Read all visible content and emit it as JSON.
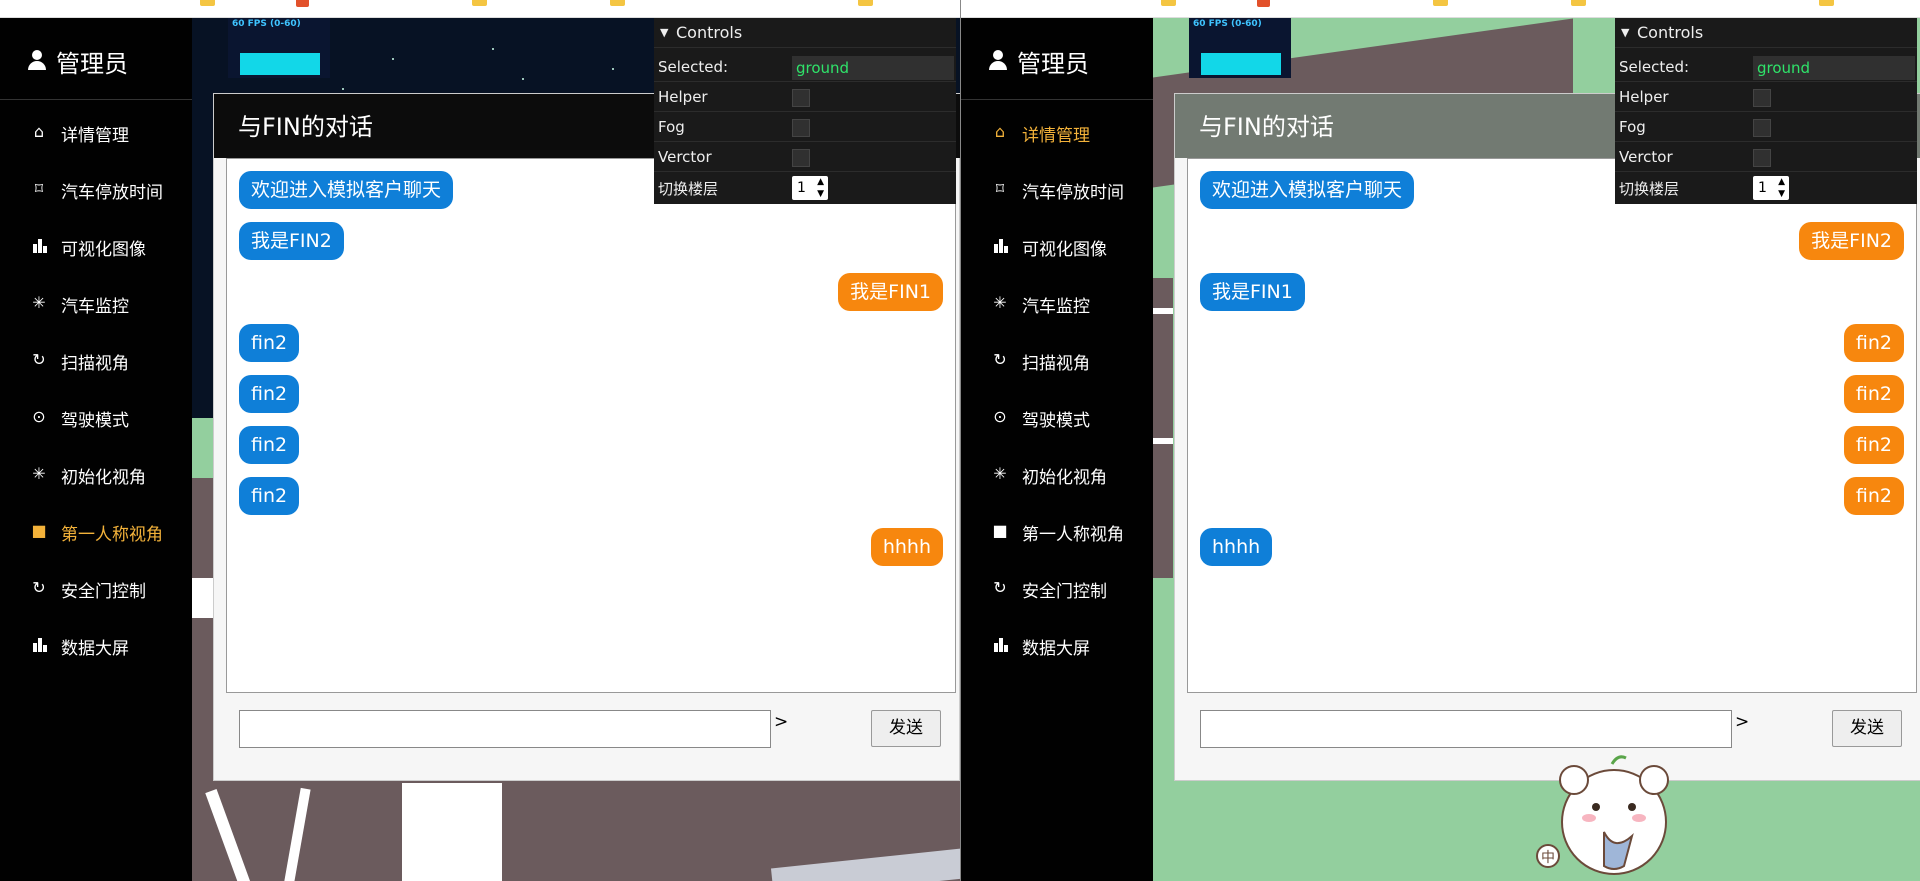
{
  "colors": {
    "sidebar_bg": "#010101",
    "active_nav": "#f3b23a",
    "bubble_blue": "#0f7fd8",
    "bubble_orange": "#f7870e",
    "gui_value_green": "#2fe36a"
  },
  "panels": [
    {
      "sidebar": {
        "admin_name": "管理员",
        "items": [
          {
            "label": "详情管理",
            "icon": "home-icon"
          },
          {
            "label": "汽车停放时间",
            "icon": "bookmark-icon"
          },
          {
            "label": "可视化图像",
            "icon": "bar-chart-icon"
          },
          {
            "label": "汽车监控",
            "icon": "spinner-icon"
          },
          {
            "label": "扫描视角",
            "icon": "scan-icon"
          },
          {
            "label": "驾驶模式",
            "icon": "location-icon"
          },
          {
            "label": "初始化视角",
            "icon": "spinner-icon"
          },
          {
            "label": "第一人称视角",
            "icon": "camera-icon"
          },
          {
            "label": "安全门控制",
            "icon": "scan-icon"
          },
          {
            "label": "数据大屏",
            "icon": "bar-chart-icon"
          }
        ],
        "active_index": 7
      },
      "fps": "60 FPS (0-60)",
      "controls": {
        "title": "Controls",
        "selected_label": "Selected:",
        "selected_value": "ground",
        "helper_label": "Helper",
        "fog_label": "Fog",
        "vector_label": "Verctor",
        "floor_label": "切换楼层",
        "floor_value": "1"
      },
      "chat": {
        "title": "与FIN的对话",
        "messages": [
          {
            "text": "欢迎进入模拟客户聊天",
            "side": "left"
          },
          {
            "text": "我是FIN2",
            "side": "left"
          },
          {
            "text": "我是FIN1",
            "side": "right"
          },
          {
            "text": "fin2",
            "side": "left"
          },
          {
            "text": "fin2",
            "side": "left"
          },
          {
            "text": "fin2",
            "side": "left"
          },
          {
            "text": "fin2",
            "side": "left"
          },
          {
            "text": "hhhh",
            "side": "right"
          }
        ],
        "input_value": "",
        "prompt_symbol": ">",
        "send_label": "发送"
      }
    },
    {
      "sidebar": {
        "admin_name": "管理员",
        "items": [
          {
            "label": "详情管理",
            "icon": "home-icon"
          },
          {
            "label": "汽车停放时间",
            "icon": "bookmark-icon"
          },
          {
            "label": "可视化图像",
            "icon": "bar-chart-icon"
          },
          {
            "label": "汽车监控",
            "icon": "spinner-icon"
          },
          {
            "label": "扫描视角",
            "icon": "scan-icon"
          },
          {
            "label": "驾驶模式",
            "icon": "location-icon"
          },
          {
            "label": "初始化视角",
            "icon": "spinner-icon"
          },
          {
            "label": "第一人称视角",
            "icon": "camera-icon"
          },
          {
            "label": "安全门控制",
            "icon": "scan-icon"
          },
          {
            "label": "数据大屏",
            "icon": "bar-chart-icon"
          }
        ],
        "active_index": 0
      },
      "fps": "60 FPS (0-60)",
      "controls": {
        "title": "Controls",
        "selected_label": "Selected:",
        "selected_value": "ground",
        "helper_label": "Helper",
        "fog_label": "Fog",
        "vector_label": "Verctor",
        "floor_label": "切换楼层",
        "floor_value": "1"
      },
      "chat": {
        "title": "与FIN的对话",
        "messages": [
          {
            "text": "欢迎进入模拟客户聊天",
            "side": "left"
          },
          {
            "text": "我是FIN2",
            "side": "right"
          },
          {
            "text": "我是FIN1",
            "side": "left"
          },
          {
            "text": "fin2",
            "side": "right"
          },
          {
            "text": "fin2",
            "side": "right"
          },
          {
            "text": "fin2",
            "side": "right"
          },
          {
            "text": "fin2",
            "side": "right"
          },
          {
            "text": "hhhh",
            "side": "left"
          }
        ],
        "input_value": "",
        "prompt_symbol": ">",
        "send_label": "发送"
      },
      "sticker_text": "中"
    }
  ]
}
